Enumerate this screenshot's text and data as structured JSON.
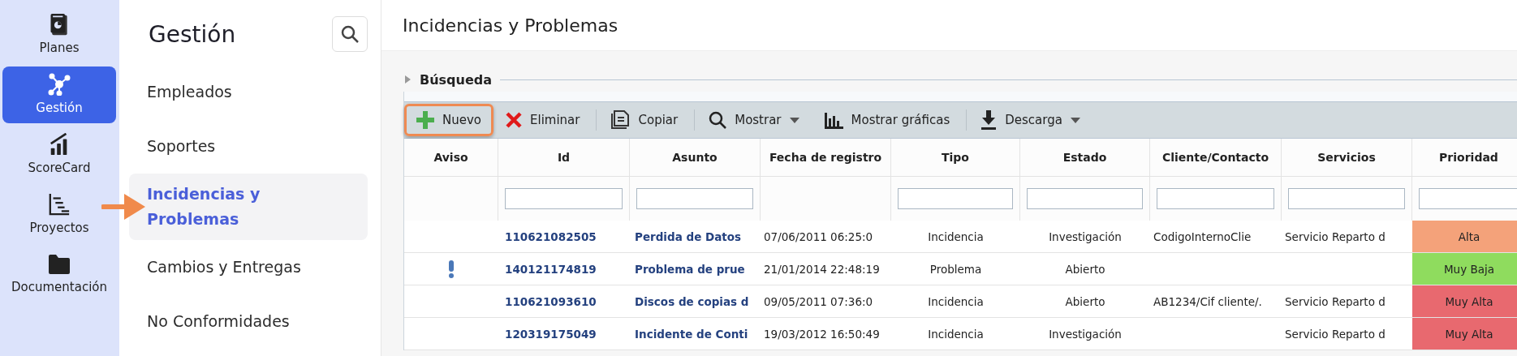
{
  "nav_rail": [
    {
      "label": "Planes",
      "selected": false
    },
    {
      "label": "Gestión",
      "selected": true
    },
    {
      "label": "ScoreCard",
      "selected": false
    },
    {
      "label": "Proyectos",
      "selected": false
    },
    {
      "label": "Documentación",
      "selected": false
    }
  ],
  "sidebar": {
    "title": "Gestión",
    "items": [
      {
        "label": "Empleados",
        "selected": false,
        "pointed": false
      },
      {
        "label": "Soportes",
        "selected": false,
        "pointed": false
      },
      {
        "label": "Incidencias y Problemas",
        "selected": true,
        "pointed": true
      },
      {
        "label": "Cambios y Entregas",
        "selected": false,
        "pointed": false
      },
      {
        "label": "No Conformidades",
        "selected": false,
        "pointed": false
      }
    ]
  },
  "page": {
    "title": "Incidencias y Problemas",
    "search_section": {
      "label": "Búsqueda",
      "expanded": false
    }
  },
  "toolbar": [
    {
      "label": "Nuevo",
      "dropdown": false,
      "highlighted": true,
      "separator_before": false
    },
    {
      "label": "Eliminar",
      "dropdown": false,
      "highlighted": false,
      "separator_before": false
    },
    {
      "label": "Copiar",
      "dropdown": false,
      "highlighted": false,
      "separator_before": true
    },
    {
      "label": "Mostrar",
      "dropdown": true,
      "highlighted": false,
      "separator_before": true
    },
    {
      "label": "Mostrar gráficas",
      "dropdown": false,
      "highlighted": false,
      "separator_before": false
    },
    {
      "label": "Descarga",
      "dropdown": true,
      "highlighted": false,
      "separator_before": true
    }
  ],
  "table": {
    "columns": [
      {
        "label": "Aviso",
        "filter": false
      },
      {
        "label": "Id",
        "filter": true
      },
      {
        "label": "Asunto",
        "filter": true
      },
      {
        "label": "Fecha de registro",
        "filter": false
      },
      {
        "label": "Tipo",
        "filter": true
      },
      {
        "label": "Estado",
        "filter": true
      },
      {
        "label": "Cliente/Contacto",
        "filter": true
      },
      {
        "label": "Servicios",
        "filter": true
      },
      {
        "label": "Prioridad",
        "filter": true
      }
    ],
    "rows": [
      {
        "alert": false,
        "id": "110621082505",
        "subject": "Perdida de Datos",
        "date": "07/06/2011 06:25:0",
        "type": "Incidencia",
        "state": "Investigación",
        "client": "CodigoInternoClie",
        "services": "Servicio Reparto d",
        "priority": "Alta",
        "color": "#f4a27a"
      },
      {
        "alert": true,
        "id": "140121174819",
        "subject": "Problema de prue",
        "date": "21/01/2014 22:48:19",
        "type": "Problema",
        "state": "Abierto",
        "client": "",
        "services": "",
        "priority": "Muy Baja",
        "color": "#8fdc5e"
      },
      {
        "alert": false,
        "id": "110621093610",
        "subject": "Discos de copias d",
        "date": "09/05/2011 07:36:0",
        "type": "Incidencia",
        "state": "Abierto",
        "client": "AB1234/Cif cliente/.",
        "services": "Servicio Reparto d",
        "priority": "Muy Alta",
        "color": "#e8696f"
      },
      {
        "alert": false,
        "id": "120319175049",
        "subject": "Incidente de Conti",
        "date": "19/03/2012 16:50:49",
        "type": "Incidencia",
        "state": "Investigación",
        "client": "",
        "services": "Servicio Reparto d",
        "priority": "Muy Alta",
        "color": "#e8696f"
      }
    ]
  }
}
